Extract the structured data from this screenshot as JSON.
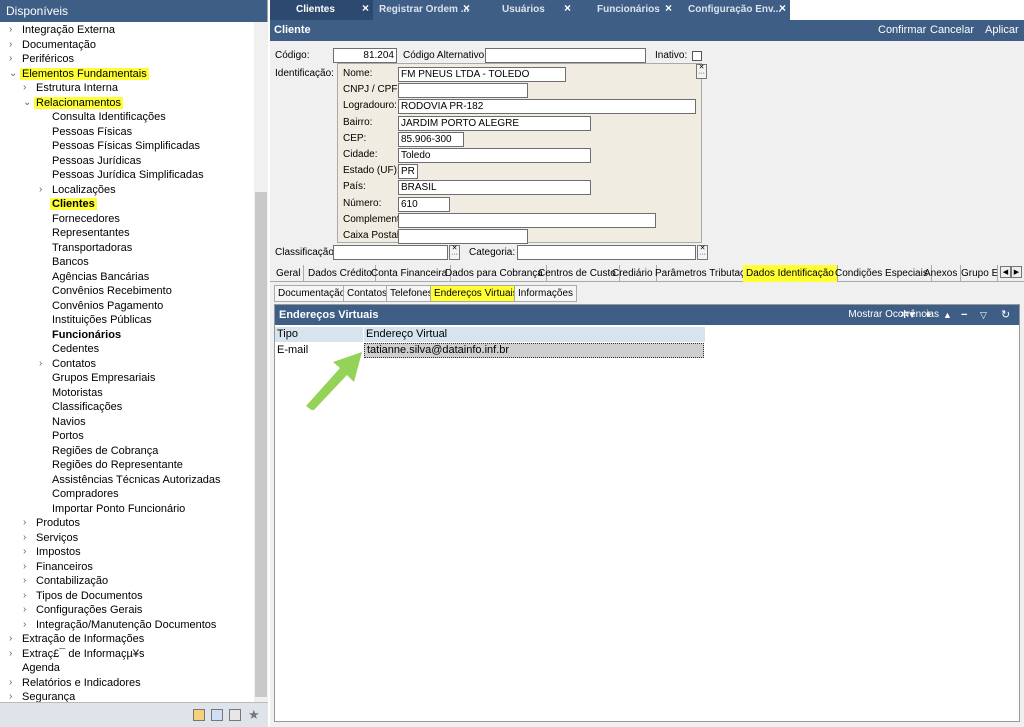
{
  "sidebar": {
    "header": "Disponíveis",
    "items": [
      {
        "label": "Integração Externa",
        "level": 0,
        "arrow": "right"
      },
      {
        "label": "Documentação",
        "level": 0,
        "arrow": "right"
      },
      {
        "label": "Periféricos",
        "level": 0,
        "arrow": "right"
      },
      {
        "label": "Elementos Fundamentais",
        "level": 0,
        "arrow": "down",
        "highlight": true
      },
      {
        "label": "Estrutura Interna",
        "level": 1,
        "arrow": "right"
      },
      {
        "label": "Relacionamentos",
        "level": 1,
        "arrow": "down",
        "highlight": true
      },
      {
        "label": "Consulta Identificações",
        "level": 2
      },
      {
        "label": "Pessoas Físicas",
        "level": 2
      },
      {
        "label": "Pessoas Físicas Simplificadas",
        "level": 2
      },
      {
        "label": "Pessoas Jurídicas",
        "level": 2
      },
      {
        "label": "Pessoas Jurídica Simplificadas",
        "level": 2
      },
      {
        "label": "Localizações",
        "level": 2,
        "arrow": "right"
      },
      {
        "label": "Clientes",
        "level": 2,
        "highlight": true,
        "bold": true
      },
      {
        "label": "Fornecedores",
        "level": 2
      },
      {
        "label": "Representantes",
        "level": 2
      },
      {
        "label": "Transportadoras",
        "level": 2
      },
      {
        "label": "Bancos",
        "level": 2
      },
      {
        "label": "Agências Bancárias",
        "level": 2
      },
      {
        "label": "Convênios Recebimento",
        "level": 2
      },
      {
        "label": "Convênios Pagamento",
        "level": 2
      },
      {
        "label": "Instituições Públicas",
        "level": 2
      },
      {
        "label": "Funcionários",
        "level": 2,
        "bold": true
      },
      {
        "label": "Cedentes",
        "level": 2
      },
      {
        "label": "Contatos",
        "level": 2,
        "arrow": "right"
      },
      {
        "label": "Grupos Empresariais",
        "level": 2
      },
      {
        "label": "Motoristas",
        "level": 2
      },
      {
        "label": "Classificações",
        "level": 2
      },
      {
        "label": "Navios",
        "level": 2
      },
      {
        "label": "Portos",
        "level": 2
      },
      {
        "label": "Regiões de Cobrança",
        "level": 2
      },
      {
        "label": "Regiões do Representante",
        "level": 2
      },
      {
        "label": "Assistências Técnicas Autorizadas",
        "level": 2
      },
      {
        "label": "Compradores",
        "level": 2
      },
      {
        "label": "Importar Ponto Funcionário",
        "level": 2
      },
      {
        "label": "Produtos",
        "level": 1,
        "arrow": "right"
      },
      {
        "label": "Serviços",
        "level": 1,
        "arrow": "right"
      },
      {
        "label": "Impostos",
        "level": 1,
        "arrow": "right"
      },
      {
        "label": "Financeiros",
        "level": 1,
        "arrow": "right"
      },
      {
        "label": "Contabilização",
        "level": 1,
        "arrow": "right"
      },
      {
        "label": "Tipos de Documentos",
        "level": 1,
        "arrow": "right"
      },
      {
        "label": "Configurações Gerais",
        "level": 1,
        "arrow": "right"
      },
      {
        "label": "Integração/Manutenção Documentos",
        "level": 1,
        "arrow": "right"
      },
      {
        "label": "Extração de Informações",
        "level": 0,
        "arrow": "right"
      },
      {
        "label": "Extraç£¯ de Informaçµ¥s",
        "level": 0,
        "arrow": "right"
      },
      {
        "label": "Agenda",
        "level": 0
      },
      {
        "label": "Relatórios e Indicadores",
        "level": 0,
        "arrow": "right"
      },
      {
        "label": "Segurança",
        "level": 0,
        "arrow": "right"
      }
    ]
  },
  "tabs": [
    {
      "label": "Clientes",
      "active": true
    },
    {
      "label": "Registrar Ordem ..."
    },
    {
      "label": "Usuários"
    },
    {
      "label": "Funcionários"
    },
    {
      "label": "Configuração Env..."
    }
  ],
  "title": "Cliente",
  "actions": {
    "confirm": "Confirmar",
    "cancel": "Cancelar",
    "apply": "Aplicar"
  },
  "form": {
    "codigo_label": "Código:",
    "codigo_value": "81.204",
    "codigo_alt_label": "Código Alternativo:",
    "codigo_alt_value": "",
    "inativo_label": "Inativo:",
    "identificacao_label": "Identificação:",
    "fields": [
      {
        "label": "Nome:",
        "value": "FM PNEUS LTDA - TOLEDO"
      },
      {
        "label": "CNPJ / CPF:",
        "value": ""
      },
      {
        "label": "Logradouro:",
        "value": "RODOVIA PR-182"
      },
      {
        "label": "Bairro:",
        "value": "JARDIM PORTO ALEGRE"
      },
      {
        "label": "CEP:",
        "value": "85.906-300"
      },
      {
        "label": "Cidade:",
        "value": "Toledo"
      },
      {
        "label": "Estado (UF):",
        "value": "PR"
      },
      {
        "label": "País:",
        "value": "BRASIL"
      },
      {
        "label": "Número:",
        "value": "610"
      },
      {
        "label": "Complemento:",
        "value": ""
      },
      {
        "label": "Caixa Postal:",
        "value": ""
      }
    ],
    "classificacao_label": "Classificação:",
    "categoria_label": "Categoria:"
  },
  "main_tabs": [
    "Geral",
    "Dados Crédito",
    "Conta Financeira",
    "Dados para Cobrança",
    "Centros de Custo",
    "Crediário",
    "Parâmetros Tributação",
    "Dados Identificação",
    "Condições Especiais",
    "Anexos",
    "Grupo Er"
  ],
  "sub_tabs": [
    "Documentação",
    "Contatos",
    "Telefones",
    "Endereços Virtuais",
    "Informações"
  ],
  "grid": {
    "title": "Endereços Virtuais",
    "show_occurrences": "Mostrar Ocorrências",
    "columns": [
      "Tipo",
      "Endereço Virtual"
    ],
    "rows": [
      {
        "tipo": "E-mail",
        "endereco": "tatianne.silva@datainfo.inf.br"
      }
    ]
  },
  "colors": {
    "header": "#3e5e85",
    "highlight": "#ffff33",
    "arrow": "#8fd14f"
  }
}
